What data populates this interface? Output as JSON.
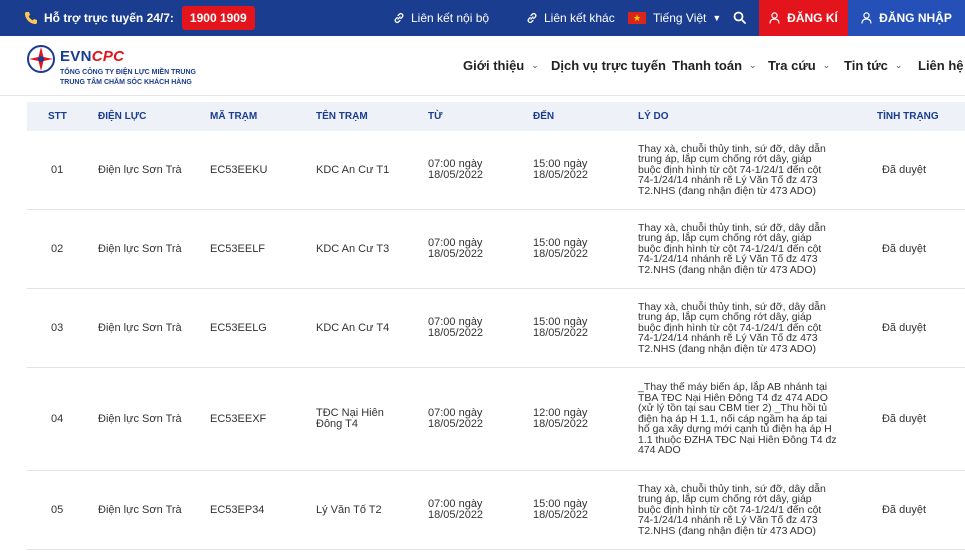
{
  "topbar": {
    "support_label": "Hỗ trợ trực tuyến 24/7:",
    "hotline": "1900 1909",
    "internal_link": "Liên kết nội bộ",
    "other_link": "Liên kết khác",
    "language": "Tiếng Việt",
    "register": "ĐĂNG KÍ",
    "login": "ĐĂNG NHẬP",
    "colors": {
      "bar": "#1a3d8f",
      "register": "#e3141c",
      "login": "#2450b8"
    }
  },
  "header": {
    "logo_name_a": "EVN",
    "logo_name_b": "CPC",
    "logo_sub1": "TỔNG CÔNG TY ĐIỆN LỰC MIỀN TRUNG",
    "logo_sub2": "TRUNG TÂM CHĂM SÓC KHÁCH HÀNG",
    "nav": [
      {
        "label": "Giới thiệu",
        "has_dropdown": true
      },
      {
        "label": "Dịch vụ trực tuyến",
        "has_dropdown": false
      },
      {
        "label": "Thanh toán",
        "has_dropdown": true
      },
      {
        "label": "Tra cứu",
        "has_dropdown": true
      },
      {
        "label": "Tin tức",
        "has_dropdown": true
      },
      {
        "label": "Liên hệ",
        "has_dropdown": false
      }
    ]
  },
  "table": {
    "columns": [
      "STT",
      "ĐIỆN LỰC",
      "MÃ TRẠM",
      "TÊN TRẠM",
      "TỪ",
      "ĐẾN",
      "LÝ DO",
      "TÌNH TRẠNG"
    ],
    "rows": [
      {
        "stt": "01",
        "unit": "Điện lực Sơn Trà",
        "code": "EC53EEKU",
        "station": [
          "KDC An Cư T1"
        ],
        "from": [
          "07:00 ngày",
          "18/05/2022"
        ],
        "to": [
          "15:00 ngày",
          "18/05/2022"
        ],
        "reason": [
          "Thay xà, chuỗi thủy tinh, sứ đỡ, dây dẫn",
          "trung áp, lắp cụm chống rớt dây, giáp",
          "buộc định hình từ cột 74-1/24/1 đến cột",
          "74-1/24/14 nhánh rẽ Lý Văn Tố đz 473",
          "T2.NHS (đang nhận điện từ 473 ADO)"
        ],
        "status": "Đã duyệt"
      },
      {
        "stt": "02",
        "unit": "Điện lực Sơn Trà",
        "code": "EC53EELF",
        "station": [
          "KDC An Cư T3"
        ],
        "from": [
          "07:00 ngày",
          "18/05/2022"
        ],
        "to": [
          "15:00 ngày",
          "18/05/2022"
        ],
        "reason": [
          "Thay xà, chuỗi thủy tinh, sứ đỡ, dây dẫn",
          "trung áp, lắp cụm chống rớt dây, giáp",
          "buộc định hình từ cột 74-1/24/1 đến cột",
          "74-1/24/14 nhánh rẽ Lý Văn Tố đz 473",
          "T2.NHS (đang nhận điện từ 473 ADO)"
        ],
        "status": "Đã duyệt"
      },
      {
        "stt": "03",
        "unit": "Điện lực Sơn Trà",
        "code": "EC53EELG",
        "station": [
          "KDC An Cư T4"
        ],
        "from": [
          "07:00 ngày",
          "18/05/2022"
        ],
        "to": [
          "15:00 ngày",
          "18/05/2022"
        ],
        "reason": [
          "Thay xà, chuỗi thủy tinh, sứ đỡ, dây dẫn",
          "trung áp, lắp cụm chống rớt dây, giáp",
          "buộc định hình từ cột 74-1/24/1 đến cột",
          "74-1/24/14 nhánh rẽ Lý Văn Tố đz 473",
          "T2.NHS (đang nhận điện từ 473 ADO)"
        ],
        "status": "Đã duyệt"
      },
      {
        "stt": "04",
        "unit": "Điện lực Sơn Trà",
        "code": "EC53EEXF",
        "station": [
          "TĐC Nại Hiên",
          "Đông T4"
        ],
        "from": [
          "07:00 ngày",
          "18/05/2022"
        ],
        "to": [
          "12:00 ngày",
          "18/05/2022"
        ],
        "reason": [
          "_Thay thế máy biến áp, lắp AB nhánh tại",
          "TBA TĐC Nại Hiên Đông T4 đz 474 ADO",
          "(xử lý tồn tại sau CBM tier 2) _Thu hồi tủ",
          "điện hạ áp H 1.1, nối cáp ngầm hạ áp tại",
          "hố ga xây dựng mới cạnh tủ điện hạ áp H",
          "1.1 thuộc ĐZHA TĐC Nại Hiên Đông T4 đz",
          "474 ADO"
        ],
        "status": "Đã duyệt"
      },
      {
        "stt": "05",
        "unit": "Điện lực Sơn Trà",
        "code": "EC53EP34",
        "station": [
          "Lý Văn Tố T2"
        ],
        "from": [
          "07:00 ngày",
          "18/05/2022"
        ],
        "to": [
          "15:00 ngày",
          "18/05/2022"
        ],
        "reason": [
          "Thay xà, chuỗi thủy tinh, sứ đỡ, dây dẫn",
          "trung áp, lắp cụm chống rớt dây, giáp",
          "buộc định hình từ cột 74-1/24/1 đến cột",
          "74-1/24/14 nhánh rẽ Lý Văn Tố đz 473",
          "T2.NHS (đang nhận điện từ 473 ADO)"
        ],
        "status": "Đã duyệt"
      }
    ]
  }
}
